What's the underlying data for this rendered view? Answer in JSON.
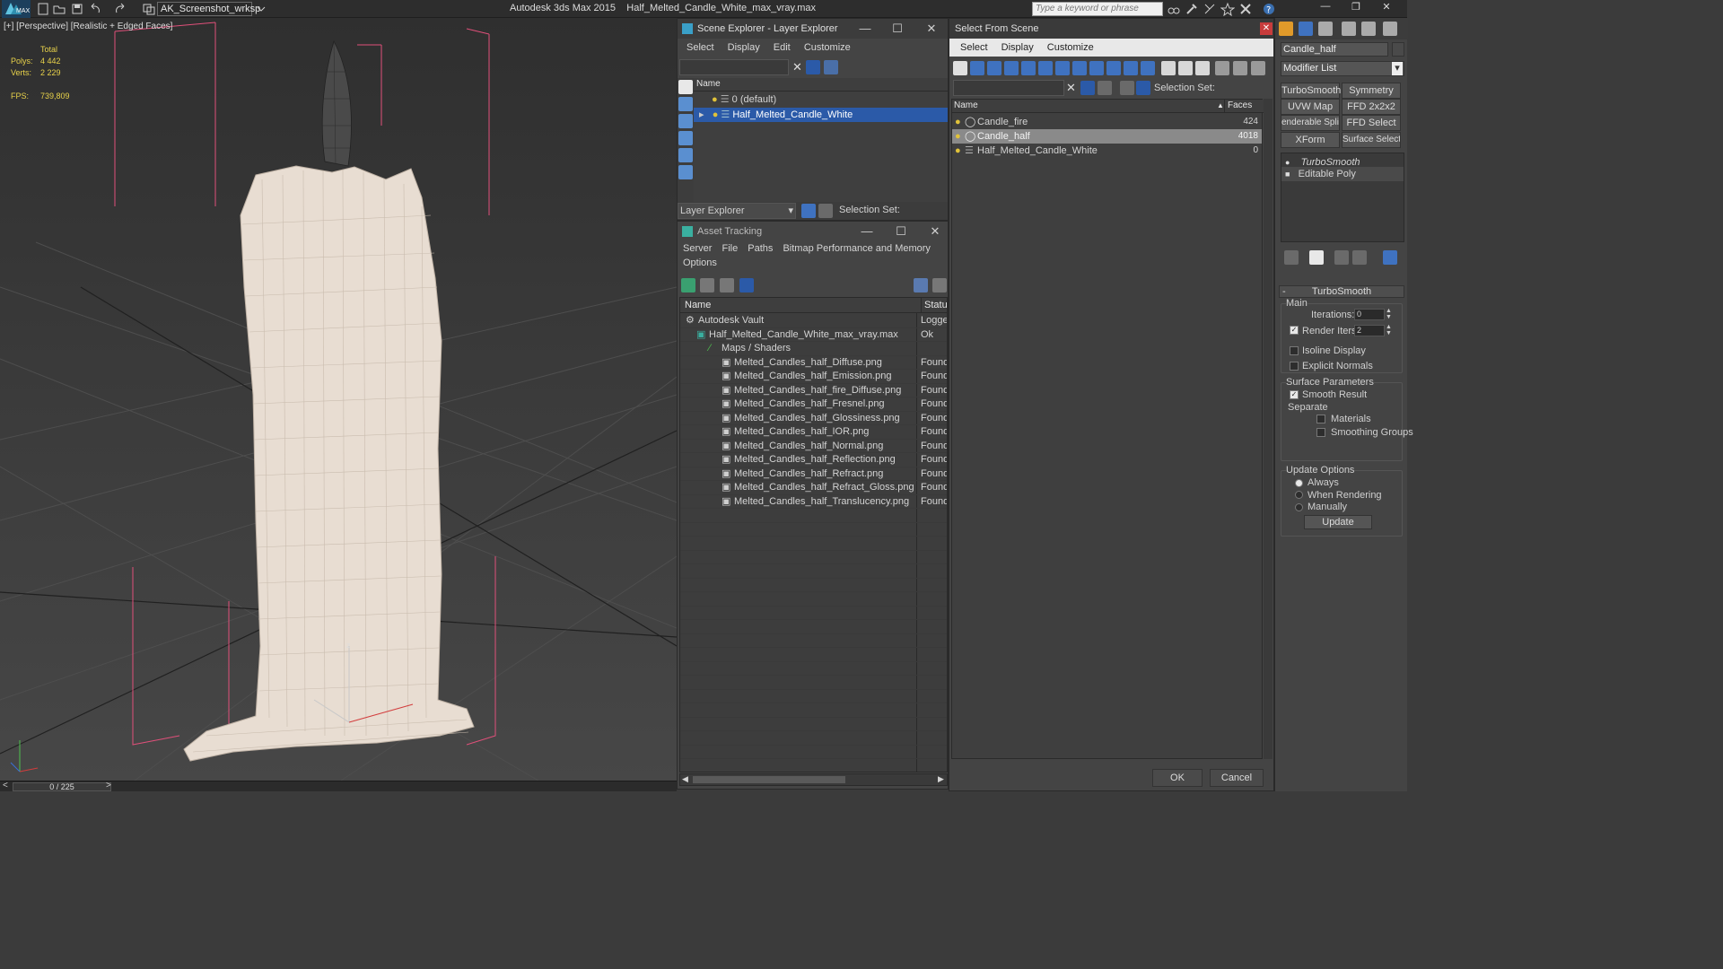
{
  "app": {
    "title": "Autodesk 3ds Max  2015",
    "file": "Half_Melted_Candle_White_max_vray.max",
    "workspace": "AK_Screenshot_wrksp",
    "search_placeholder": "Type a keyword or phrase",
    "logo": "MAX"
  },
  "viewport": {
    "label": "[+] [Perspective] [Realistic + Edged Faces]",
    "stats": {
      "total": "Total",
      "polys_label": "Polys:",
      "polys": "4 442",
      "verts_label": "Verts:",
      "verts": "2 229",
      "fps_label": "FPS:",
      "fps": "739,809"
    },
    "axis_z": "z",
    "axis_x": "x"
  },
  "timeline": {
    "counter": "0 / 225",
    "prev": "<",
    "next": ">"
  },
  "scene_explorer": {
    "title": "Scene Explorer - Layer Explorer",
    "menu": [
      "Select",
      "Display",
      "Edit",
      "Customize"
    ],
    "column": "Name",
    "rows": [
      {
        "name": "0 (default)"
      },
      {
        "name": "Half_Melted_Candle_White",
        "selected": true
      }
    ],
    "footer_label": "Layer Explorer",
    "selection_set": "Selection Set:"
  },
  "asset_tracking": {
    "title": "Asset Tracking",
    "menu": [
      "Server",
      "File",
      "Paths",
      "Bitmap Performance and Memory",
      "Options"
    ],
    "col_name": "Name",
    "col_status": "Status",
    "rows": [
      {
        "name": "Autodesk Vault",
        "status": "Logged"
      },
      {
        "name": "Half_Melted_Candle_White_max_vray.max",
        "status": "Ok"
      },
      {
        "name": "Maps / Shaders",
        "status": ""
      },
      {
        "name": "Melted_Candles_half_Diffuse.png",
        "status": "Found"
      },
      {
        "name": "Melted_Candles_half_Emission.png",
        "status": "Found"
      },
      {
        "name": "Melted_Candles_half_fire_Diffuse.png",
        "status": "Found"
      },
      {
        "name": "Melted_Candles_half_Fresnel.png",
        "status": "Found"
      },
      {
        "name": "Melted_Candles_half_Glossiness.png",
        "status": "Found"
      },
      {
        "name": "Melted_Candles_half_IOR.png",
        "status": "Found"
      },
      {
        "name": "Melted_Candles_half_Normal.png",
        "status": "Found"
      },
      {
        "name": "Melted_Candles_half_Reflection.png",
        "status": "Found"
      },
      {
        "name": "Melted_Candles_half_Refract.png",
        "status": "Found"
      },
      {
        "name": "Melted_Candles_half_Refract_Gloss.png",
        "status": "Found"
      },
      {
        "name": "Melted_Candles_half_Translucency.png",
        "status": "Found"
      }
    ]
  },
  "select_from_scene": {
    "title": "Select From Scene",
    "menu": [
      "Select",
      "Display",
      "Customize"
    ],
    "selection_set": "Selection Set:",
    "col_name": "Name",
    "col_faces": "Faces",
    "rows": [
      {
        "name": "Candle_fire",
        "faces": "424"
      },
      {
        "name": "Candle_half",
        "faces": "4018",
        "selected": true
      },
      {
        "name": "Half_Melted_Candle_White",
        "faces": "0"
      }
    ],
    "ok": "OK",
    "cancel": "Cancel"
  },
  "command_panel": {
    "object_name": "Candle_half",
    "modifier_list": "Modifier List",
    "buttons": [
      "TurboSmooth",
      "Symmetry",
      "UVW Map",
      "FFD 2x2x2",
      "enderable Splir",
      "FFD Select",
      "XForm",
      "Surface Select"
    ],
    "stack": [
      "TurboSmooth",
      "Editable Poly"
    ],
    "rollout": "TurboSmooth",
    "main": "Main",
    "iterations_label": "Iterations:",
    "iterations": "0",
    "render_iters_label": "Render Iters:",
    "render_iters": "2",
    "isoline": "Isoline Display",
    "explicit_normals": "Explicit Normals",
    "surface_params": "Surface Parameters",
    "smooth_result": "Smooth Result",
    "separate": "Separate",
    "materials": "Materials",
    "smoothing_groups": "Smoothing Groups",
    "update_options": "Update Options",
    "always": "Always",
    "when_rendering": "When Rendering",
    "manually": "Manually",
    "update": "Update"
  },
  "colors": {
    "selection": "#2b5aa8",
    "accent": "#e0c23a",
    "stats": "#e8d24a",
    "bbox": "#e0507a"
  }
}
